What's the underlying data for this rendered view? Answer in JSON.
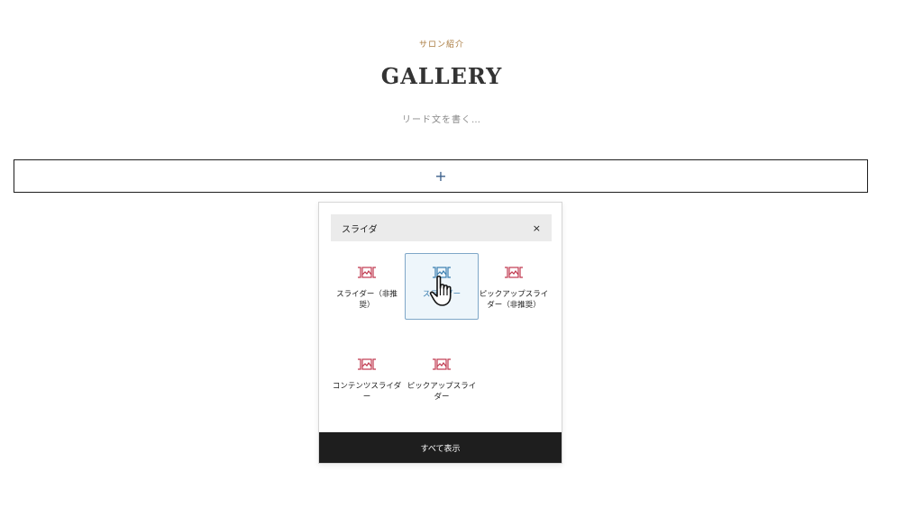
{
  "section": {
    "eyebrow": "サロン紹介",
    "title": "GALLERY",
    "lead": "リード文を書く…"
  },
  "appender": {
    "icon": "plus-icon",
    "label": "+"
  },
  "inserter": {
    "search": {
      "value": "スライダ",
      "clear_icon": "close-icon",
      "clear_label": "×"
    },
    "blocks": [
      {
        "label": "スライダー（非推奨）",
        "icon": "slider-icon",
        "icon_color": "#c0394f",
        "selected": false
      },
      {
        "label": "スライダー",
        "icon": "slider-icon",
        "icon_color": "#3a7fb0",
        "selected": true
      },
      {
        "label": "ピックアップスライダー（非推奨）",
        "icon": "slider-icon",
        "icon_color": "#c0394f",
        "selected": false
      },
      {
        "label": "コンテンツスライダー",
        "icon": "slider-icon",
        "icon_color": "#c0394f",
        "selected": false
      },
      {
        "label": "ピックアップスライダー",
        "icon": "slider-icon",
        "icon_color": "#c0394f",
        "selected": false
      }
    ],
    "show_all_label": "すべて表示"
  },
  "colors": {
    "accent": "#a97a3e",
    "block_icon": "#c0394f",
    "selected_icon": "#3a7fb0",
    "footer_bg": "#1e1e1e"
  }
}
